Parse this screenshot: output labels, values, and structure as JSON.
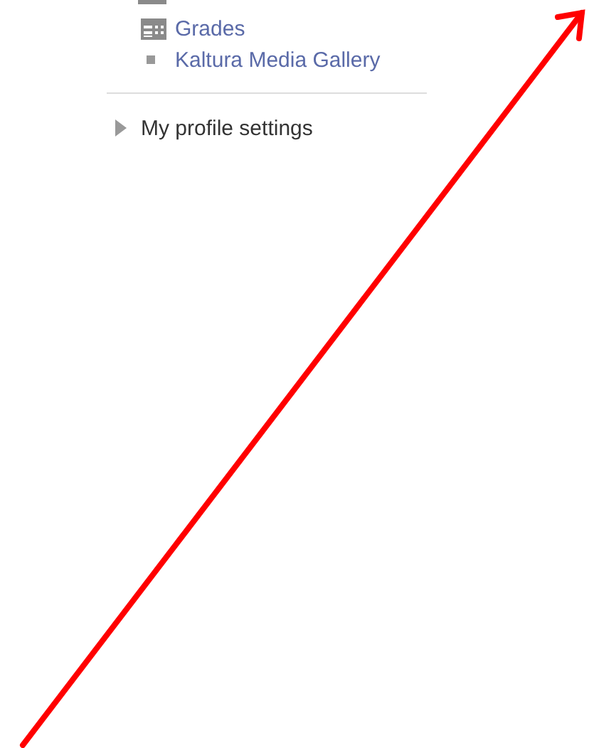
{
  "navigation": {
    "items": [
      {
        "label": "Grades",
        "kind": "table"
      },
      {
        "label": "Kaltura Media Gallery",
        "kind": "bullet"
      }
    ]
  },
  "sections": [
    {
      "label": "My profile settings",
      "expanded": false
    }
  ]
}
